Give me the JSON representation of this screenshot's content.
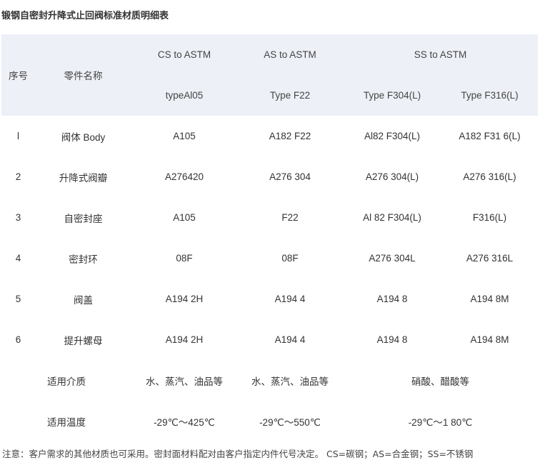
{
  "title": "锻钢自密封升降式止回阀标准材质明细表",
  "header": {
    "col_no": "序号",
    "col_part": "零件名称",
    "cs_standard": "CS to ASTM",
    "as_standard": "AS to ASTM",
    "ss_standard": "SS to ASTM",
    "cs_type": "typeAl05",
    "as_type": "Type F22",
    "ss_type_1": "Type F304(L)",
    "ss_type_2": "Type F316(L)"
  },
  "rows": [
    {
      "no": "l",
      "part": "阀体 Body",
      "cs": "A105",
      "as": "A182 F22",
      "ss1": "Al82 F304(L)",
      "ss2": "A182 F31 6(L)"
    },
    {
      "no": "2",
      "part": "升降式阀瓣",
      "cs": "A276420",
      "as": "A276 304",
      "ss1": "A276 304(L)",
      "ss2": "A276 316(L)"
    },
    {
      "no": "3",
      "part": "自密封座",
      "cs": "A105",
      "as": "F22",
      "ss1": "Al 82 F304(L)",
      "ss2": "F316(L)"
    },
    {
      "no": "4",
      "part": "密封环",
      "cs": "08F",
      "as": "08F",
      "ss1": "A276 304L",
      "ss2": "A276 316L"
    },
    {
      "no": "5",
      "part": "阀盖",
      "cs": "A194 2H",
      "as": "A194 4",
      "ss1": "A194 8",
      "ss2": "A194 8M"
    },
    {
      "no": "6",
      "part": "提升螺母",
      "cs": "A194 2H",
      "as": "A194 4",
      "ss1": "A194 8",
      "ss2": "A194 8M"
    }
  ],
  "medium": {
    "label": "适用介质",
    "cs": "水、蒸汽、油品等",
    "as": "水、蒸汽、油品等",
    "ss": "硝酸、醋酸等"
  },
  "temperature": {
    "label": "适用温度",
    "cs": "-29℃～425℃",
    "as": "-29℃～550℃",
    "ss": "-29℃～1 80℃"
  },
  "note": "注意：客户需求的其他材质也可采用。密封面材料配对由客户指定内件代号决定。 CS=碳钢；AS=合金钢；SS=不锈钢"
}
